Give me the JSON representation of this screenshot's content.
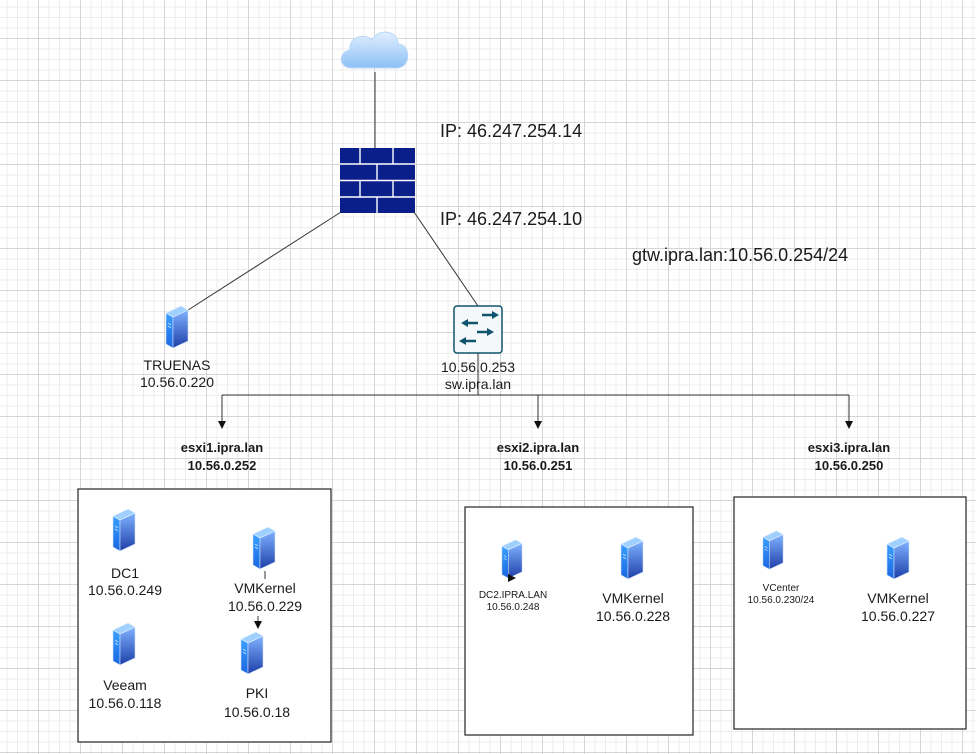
{
  "internet": {
    "icon": "cloud-icon"
  },
  "firewall": {
    "icon": "firewall-icon",
    "ip_wan": "IP: 46.247.254.14",
    "ip_lan": "IP: 46.247.254.10",
    "color": "#0a1f8a"
  },
  "gateway": {
    "label": "gtw.ipra.lan:10.56.0.254/24"
  },
  "truenas": {
    "name": "TRUENAS",
    "ip": "10.56.0.220"
  },
  "switch": {
    "icon": "switch-icon",
    "ip": "10.56.0.253",
    "name": "sw.ipra.lan",
    "color": "#10546e"
  },
  "hosts": [
    {
      "name": "esxi1.ipra.lan",
      "ip": "10.56.0.252",
      "vms": [
        {
          "name": "DC1",
          "ip": "10.56.0.249"
        },
        {
          "name": "VMKernel",
          "ip": "10.56.0.229"
        },
        {
          "name": "Veeam",
          "ip": "10.56.0.118"
        },
        {
          "name": "PKI",
          "ip": "10.56.0.18"
        }
      ]
    },
    {
      "name": "esxi2.ipra.lan",
      "ip": "10.56.0.251",
      "vms": [
        {
          "name": "DC2.IPRA.LAN",
          "ip": "10.56.0.248"
        },
        {
          "name": "VMKernel",
          "ip": "10.56.0.228"
        }
      ]
    },
    {
      "name": "esxi3.ipra.lan",
      "ip": "10.56.0.250",
      "vms": [
        {
          "name": "VCenter",
          "ip": "10.56.0.230/24"
        },
        {
          "name": "VMKernel",
          "ip": "10.56.0.227"
        }
      ]
    }
  ]
}
